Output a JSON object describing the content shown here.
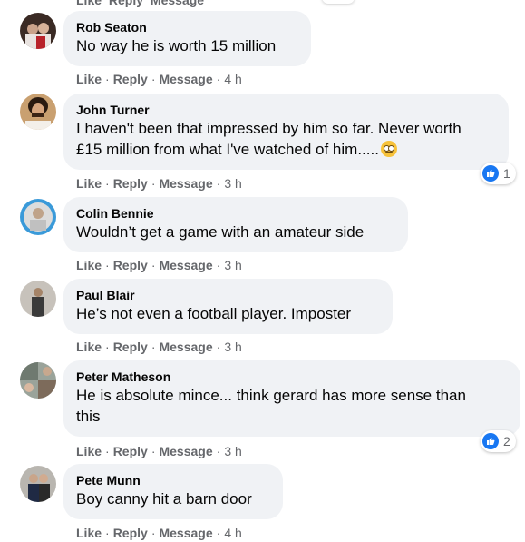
{
  "top_fade": {
    "like": "Like",
    "reply": "Reply",
    "message": "Message"
  },
  "actions": {
    "like": "Like",
    "reply": "Reply",
    "message": "Message",
    "separator": "·"
  },
  "comments": [
    {
      "author": "Rob Seaton",
      "text": "No way he is worth 15 million",
      "time": "4 h",
      "reactions": null
    },
    {
      "author": "John Turner",
      "text_line1": "I haven't been that impressed by him so far. Never worth",
      "text_line2": "£15 million from what I've watched of him.....",
      "emoji": "rolling-eyes-emoji",
      "time": "3 h",
      "reactions": "1"
    },
    {
      "author": "Colin Bennie",
      "text": "Wouldn’t get a game with an amateur side",
      "time": "3 h",
      "reactions": null
    },
    {
      "author": "Paul Blair",
      "text": "He’s not even a football player. Imposter",
      "time": "3 h",
      "reactions": null
    },
    {
      "author": "Peter Matheson",
      "text_line1": "He is absolute mince... think gerard has more sense than",
      "text_line2": "this",
      "time": "3 h",
      "reactions": "2"
    },
    {
      "author": "Pete Munn",
      "text": "Boy canny hit a barn door",
      "time": "4 h",
      "reactions": null
    }
  ],
  "colors": {
    "bubble": "#f0f2f5",
    "meta": "#65676b",
    "like_blue": "#1877f2"
  }
}
